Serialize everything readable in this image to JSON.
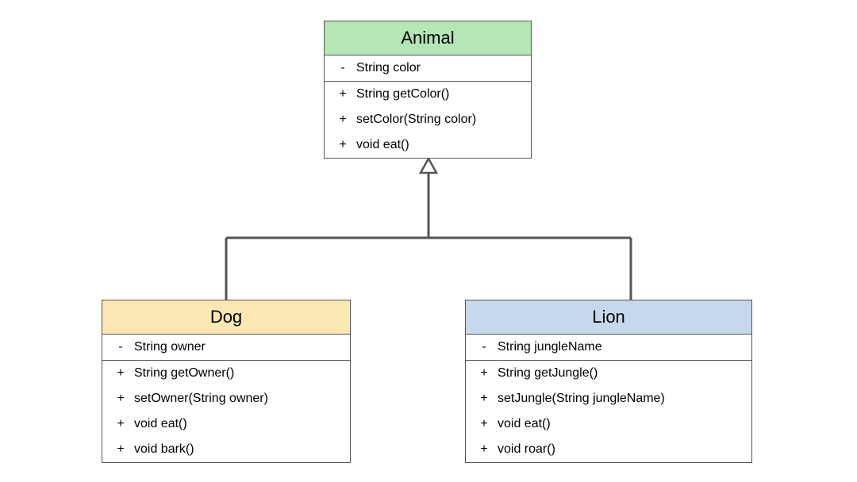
{
  "classes": {
    "animal": {
      "name": "Animal",
      "headerColor": "#b5e6b5",
      "attributes": [
        {
          "visibility": "-",
          "signature": "String color"
        }
      ],
      "methods": [
        {
          "visibility": "+",
          "signature": "String getColor()"
        },
        {
          "visibility": "+",
          "signature": "setColor(String color)"
        },
        {
          "visibility": "+",
          "signature": "void eat()"
        }
      ]
    },
    "dog": {
      "name": "Dog",
      "headerColor": "#fce8b2",
      "attributes": [
        {
          "visibility": "-",
          "signature": "String owner"
        }
      ],
      "methods": [
        {
          "visibility": "+",
          "signature": "String getOwner()"
        },
        {
          "visibility": "+",
          "signature": "setOwner(String owner)"
        },
        {
          "visibility": "+",
          "signature": "void eat()"
        },
        {
          "visibility": "+",
          "signature": "void bark()"
        }
      ]
    },
    "lion": {
      "name": "Lion",
      "headerColor": "#c6d9ec",
      "attributes": [
        {
          "visibility": "-",
          "signature": "String jungleName"
        }
      ],
      "methods": [
        {
          "visibility": "+",
          "signature": "String getJungle()"
        },
        {
          "visibility": "+",
          "signature": "setJungle(String jungleName)"
        },
        {
          "visibility": "+",
          "signature": "void eat()"
        },
        {
          "visibility": "+",
          "signature": "void roar()"
        }
      ]
    }
  },
  "relationships": [
    {
      "from": "dog",
      "to": "animal",
      "type": "inheritance"
    },
    {
      "from": "lion",
      "to": "animal",
      "type": "inheritance"
    }
  ]
}
